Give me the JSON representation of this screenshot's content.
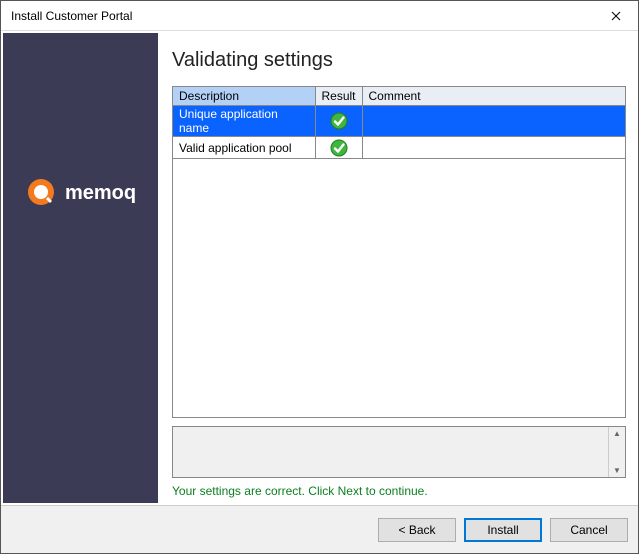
{
  "window": {
    "title": "Install Customer Portal"
  },
  "sidebar": {
    "brand": "memoq"
  },
  "main": {
    "heading": "Validating settings",
    "columns": {
      "description": "Description",
      "result": "Result",
      "comment": "Comment"
    },
    "rows": [
      {
        "description": "Unique application name",
        "result": "ok",
        "comment": "",
        "selected": true
      },
      {
        "description": "Valid application pool",
        "result": "ok",
        "comment": "",
        "selected": false
      }
    ],
    "details": "",
    "status": "Your settings are correct. Click Next to continue."
  },
  "footer": {
    "back": "< Back",
    "install": "Install",
    "cancel": "Cancel"
  }
}
